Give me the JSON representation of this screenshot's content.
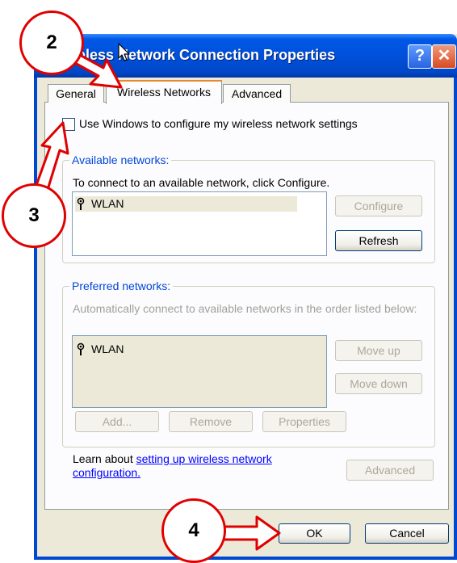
{
  "window": {
    "title": "Wireless Network Connection Properties",
    "title_visible": "eless Network Connection Properties",
    "help_glyph": "?",
    "close_glyph": "✕"
  },
  "tabs": [
    {
      "label": "General"
    },
    {
      "label": "Wireless Networks",
      "active": true
    },
    {
      "label": "Advanced"
    }
  ],
  "checkbox": {
    "label": "Use Windows to configure my wireless network settings",
    "checked": false
  },
  "available": {
    "title": "Available networks:",
    "description": "To connect to an available network, click Configure.",
    "items": [
      {
        "name": "WLAN",
        "icon": "antenna-icon"
      }
    ],
    "configure_label": "Configure",
    "refresh_label": "Refresh"
  },
  "preferred": {
    "title": "Preferred networks:",
    "description": "Automatically connect to available networks in the order listed below:",
    "items": [
      {
        "name": "WLAN",
        "icon": "antenna-icon"
      }
    ],
    "move_up_label": "Move up",
    "move_down_label": "Move down",
    "add_label": "Add...",
    "remove_label": "Remove",
    "properties_label": "Properties"
  },
  "learn": {
    "prefix": "Learn about ",
    "link": "setting up wireless network configuration."
  },
  "advanced_label": "Advanced",
  "footer": {
    "ok_label": "OK",
    "cancel_label": "Cancel"
  },
  "annotations": [
    {
      "number": "2"
    },
    {
      "number": "3"
    },
    {
      "number": "4"
    }
  ],
  "colors": {
    "annotation_red": "#e00000",
    "titlebar_blue": "#0050da",
    "group_title_blue": "#0046d5",
    "active_tab_accent": "#e68b2c",
    "link_blue": "#0000ff"
  }
}
